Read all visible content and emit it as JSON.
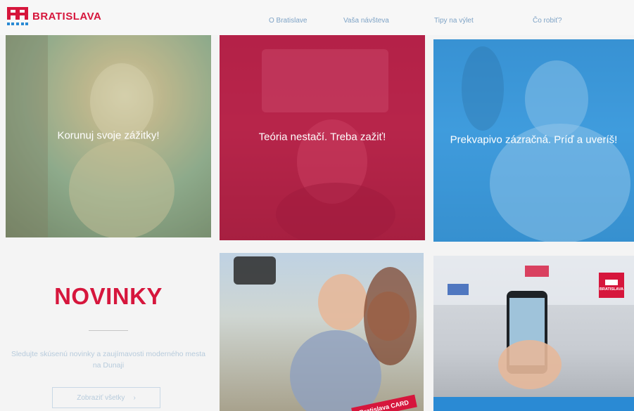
{
  "header": {
    "logo_text": "BRATISLAVA",
    "nav": [
      "O Bratislave",
      "Vaša návšteva",
      "Tipy na výlet",
      "Čo robiť?"
    ]
  },
  "tiles": [
    {
      "caption": "Korunuj svoje zážitky!"
    },
    {
      "caption": "Teória nestačí. Treba zažiť!"
    },
    {
      "caption": "Prekvapivo zázračná. Príď a uveríš!"
    }
  ],
  "news": {
    "title": "NOVINKY",
    "description": "Sledujte skúsenú novinky a zaujímavosti moderného mesta na Dunaji",
    "button_label": "Zobraziť všetky",
    "button_chevron": "›"
  },
  "promo": {
    "card_text": "Bratislava CARD",
    "badge_text": "BRATISLAVA"
  },
  "colors": {
    "brand_red": "#d6163c",
    "brand_blue": "#2a8ad4"
  },
  "icons": [
    "logo-icon",
    "chevron-right-icon"
  ]
}
